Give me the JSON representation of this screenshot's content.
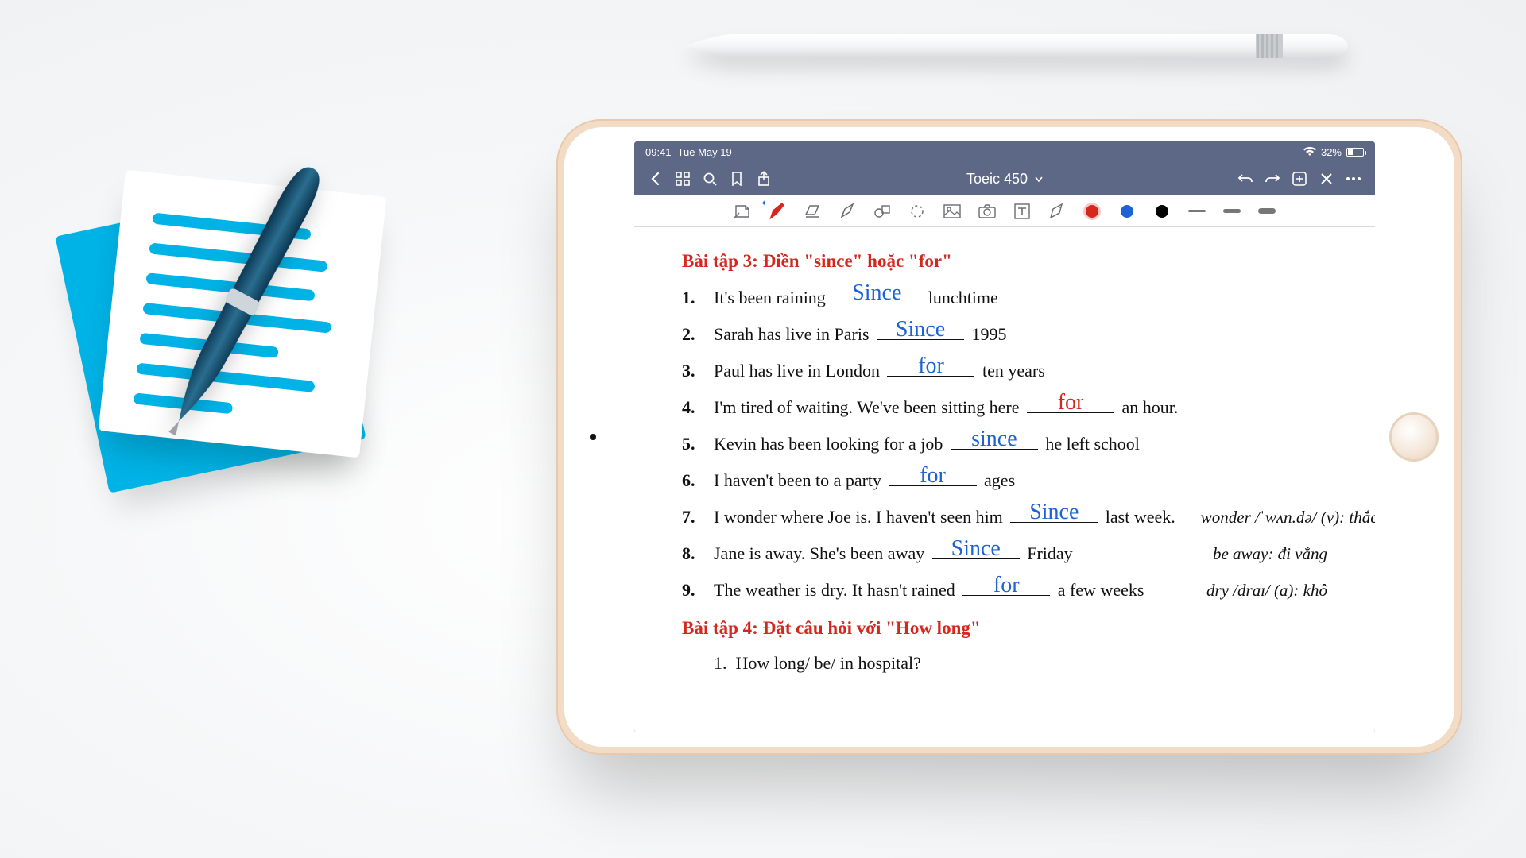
{
  "statusbar": {
    "time": "09:41",
    "date": "Tue May 19",
    "battery_pct": "32%"
  },
  "titlebar": {
    "title": "Toeic 450"
  },
  "tools": {
    "color_red": "#d5271e",
    "color_blue": "#1e63d6",
    "color_black": "#000000",
    "color_grey": "#8b8b8b"
  },
  "doc": {
    "heading3": "Bài tập 3: Điền \"since\" hoặc \"for\"",
    "heading4": "Bài tập 4: Đặt câu hỏi với \"How long\"",
    "items4_first": "How long/ be/ in hospital?",
    "items": [
      {
        "n": "1.",
        "before": "It's been raining",
        "ans": "Since",
        "ansColor": "blue",
        "after": "lunchtime",
        "gloss": ""
      },
      {
        "n": "2.",
        "before": "Sarah has live in Paris",
        "ans": "Since",
        "ansColor": "blue",
        "after": "1995",
        "gloss": ""
      },
      {
        "n": "3.",
        "before": "Paul has live in London",
        "ans": "for",
        "ansColor": "blue",
        "after": "ten years",
        "gloss": ""
      },
      {
        "n": "4.",
        "before": "I'm tired of waiting. We've been sitting here",
        "ans": "for",
        "ansColor": "red",
        "after": "an hour.",
        "gloss": ""
      },
      {
        "n": "5.",
        "before": "Kevin has been looking for a job",
        "ans": "since",
        "ansColor": "blue",
        "after": "he left school",
        "gloss": ""
      },
      {
        "n": "6.",
        "before": "I haven't been to a party",
        "ans": "for",
        "ansColor": "blue",
        "after": "ages",
        "gloss": ""
      },
      {
        "n": "7.",
        "before": "I wonder where Joe is. I haven't seen him",
        "ans": "Since",
        "ansColor": "blue",
        "after": "last week.",
        "gloss": "wonder /ˈwʌn.də/ (v): thắc mắc"
      },
      {
        "n": "8.",
        "before": "Jane is away. She's been away",
        "ans": "Since",
        "ansColor": "blue",
        "after": "Friday",
        "gloss": "be away: đi vắng"
      },
      {
        "n": "9.",
        "before": "The weather is dry. It hasn't rained",
        "ans": "for",
        "ansColor": "blue",
        "after": "a few weeks",
        "gloss": "dry /draɪ/ (a): khô"
      }
    ]
  }
}
